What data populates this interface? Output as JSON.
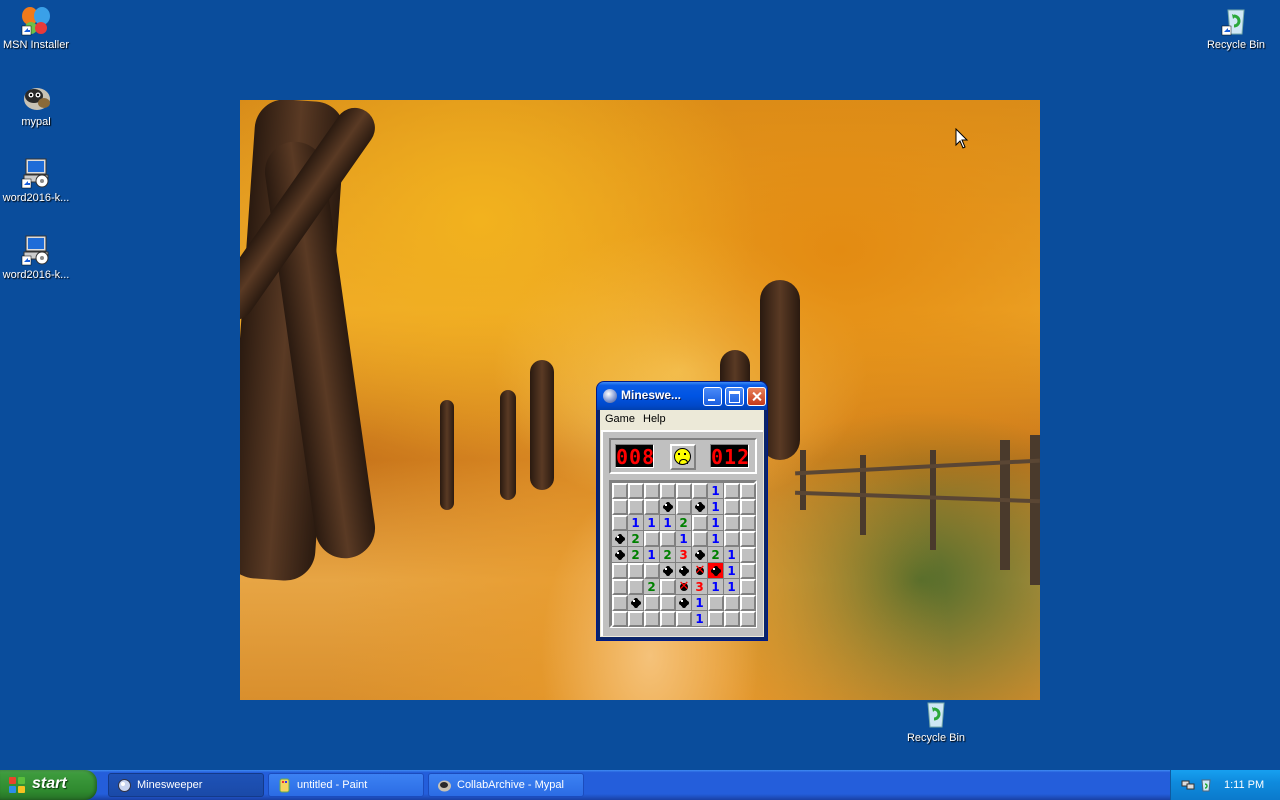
{
  "desktop": {
    "icons": [
      {
        "label": "MSN Installer",
        "icon": "msn-butterfly-icon"
      },
      {
        "label": "mypal",
        "icon": "mypal-raccoon-icon"
      },
      {
        "label": "word2016-k...",
        "icon": "installer-icon"
      },
      {
        "label": "word2016-k...",
        "icon": "installer-icon"
      },
      {
        "label": "Recycle Bin",
        "icon": "recycle-bin-icon"
      },
      {
        "label": "Recycle Bin",
        "icon": "recycle-bin-icon"
      }
    ],
    "background_color": "#0a4d9c",
    "wallpaper": "autumn-forest-path-wallpaper"
  },
  "minesweeper": {
    "title": "Mineswe...",
    "menu": [
      "Game",
      "Help"
    ],
    "mine_counter": "008",
    "timer": "012",
    "face": "sad",
    "grid": [
      [
        "h",
        "h",
        "h",
        "h",
        "h",
        "h",
        "1",
        "h",
        "h"
      ],
      [
        "h",
        "h",
        "h",
        "mine",
        "h",
        "mine",
        "1",
        "h",
        "h"
      ],
      [
        "h",
        "1",
        "1",
        "1",
        "2",
        "h",
        "1",
        "h",
        "h"
      ],
      [
        "mine",
        "2",
        "h",
        "h",
        "1",
        "h",
        "1",
        "h",
        "h"
      ],
      [
        "mine",
        "2",
        "1",
        "2",
        "3",
        "mine",
        "2",
        "1",
        "h"
      ],
      [
        "h",
        "h",
        "h",
        "mine",
        "mine",
        "wrong",
        "boom",
        "1",
        "h"
      ],
      [
        "h",
        "h",
        "2",
        "h",
        "wrong",
        "3",
        "1",
        "1",
        "h"
      ],
      [
        "h",
        "mine",
        "h",
        "h",
        "mine",
        "1",
        "h",
        "h",
        "h"
      ],
      [
        "h",
        "h",
        "h",
        "h",
        "h",
        "1",
        "h",
        "h",
        "h"
      ]
    ]
  },
  "taskbar": {
    "start_label": "start",
    "tasks": [
      {
        "label": "Minesweeper",
        "active": true,
        "icon": "minesweeper-icon"
      },
      {
        "label": "untitled - Paint",
        "active": false,
        "icon": "paint-icon"
      },
      {
        "label": "CollabArchive - Mypal",
        "active": false,
        "icon": "mypal-icon"
      }
    ],
    "clock": "1:11 PM",
    "tray_icons": [
      "network-icon",
      "recycle-tray-icon"
    ]
  }
}
